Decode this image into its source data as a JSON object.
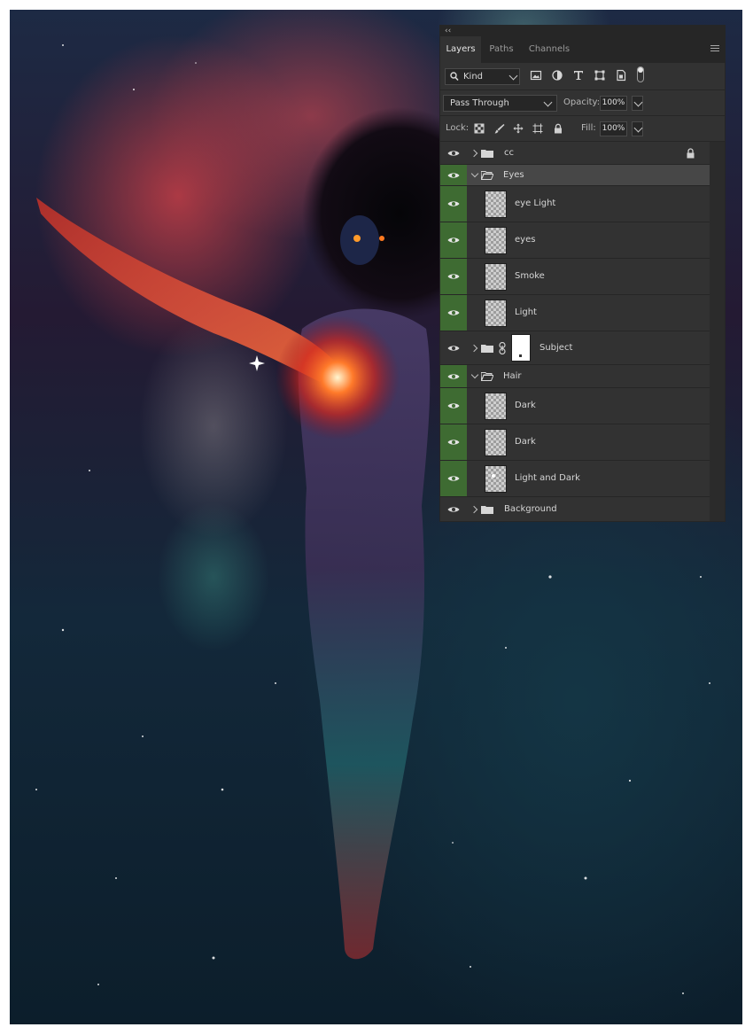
{
  "panel": {
    "collapse_glyph": "‹‹",
    "tabs": [
      {
        "label": "Layers",
        "active": true
      },
      {
        "label": "Paths",
        "active": false
      },
      {
        "label": "Channels",
        "active": false
      }
    ],
    "filter": {
      "kind_label": "Kind",
      "filter_icons": [
        "image-filter-icon",
        "adjustment-filter-icon",
        "type-filter-icon",
        "shape-filter-icon",
        "smart-object-filter-icon"
      ]
    },
    "blend": {
      "mode": "Pass Through",
      "opacity_label": "Opacity:",
      "opacity_value": "100%"
    },
    "lock_row": {
      "lock_label": "Lock:",
      "fill_label": "Fill:",
      "fill_value": "100%"
    },
    "layers": [
      {
        "name": "cc",
        "type": "group",
        "expanded": false,
        "locked": true,
        "selected": false,
        "eye_green": false
      },
      {
        "name": "Eyes",
        "type": "group",
        "expanded": true,
        "locked": false,
        "selected": true,
        "eye_green": true
      },
      {
        "name": "eye Light",
        "type": "layer",
        "selected": false,
        "eye_green": true
      },
      {
        "name": "eyes",
        "type": "layer",
        "selected": false,
        "eye_green": true
      },
      {
        "name": "Smoke",
        "type": "layer",
        "selected": false,
        "eye_green": true
      },
      {
        "name": "Light",
        "type": "layer",
        "selected": false,
        "eye_green": true
      },
      {
        "name": "Subject",
        "type": "group-masked",
        "expanded": false,
        "selected": false,
        "eye_green": false
      },
      {
        "name": "Hair",
        "type": "group",
        "expanded": true,
        "selected": false,
        "eye_green": true
      },
      {
        "name": "Dark",
        "type": "layer",
        "selected": false,
        "eye_green": true
      },
      {
        "name": "Dark",
        "type": "layer",
        "selected": false,
        "eye_green": true
      },
      {
        "name": "Light and Dark",
        "type": "layer",
        "selected": false,
        "eye_green": true
      },
      {
        "name": "Background",
        "type": "group",
        "expanded": false,
        "selected": false,
        "eye_green": false
      }
    ]
  },
  "colors": {
    "panel_bg": "#323232",
    "selected_row": "#474747",
    "eye_active": "#3e6b32"
  }
}
